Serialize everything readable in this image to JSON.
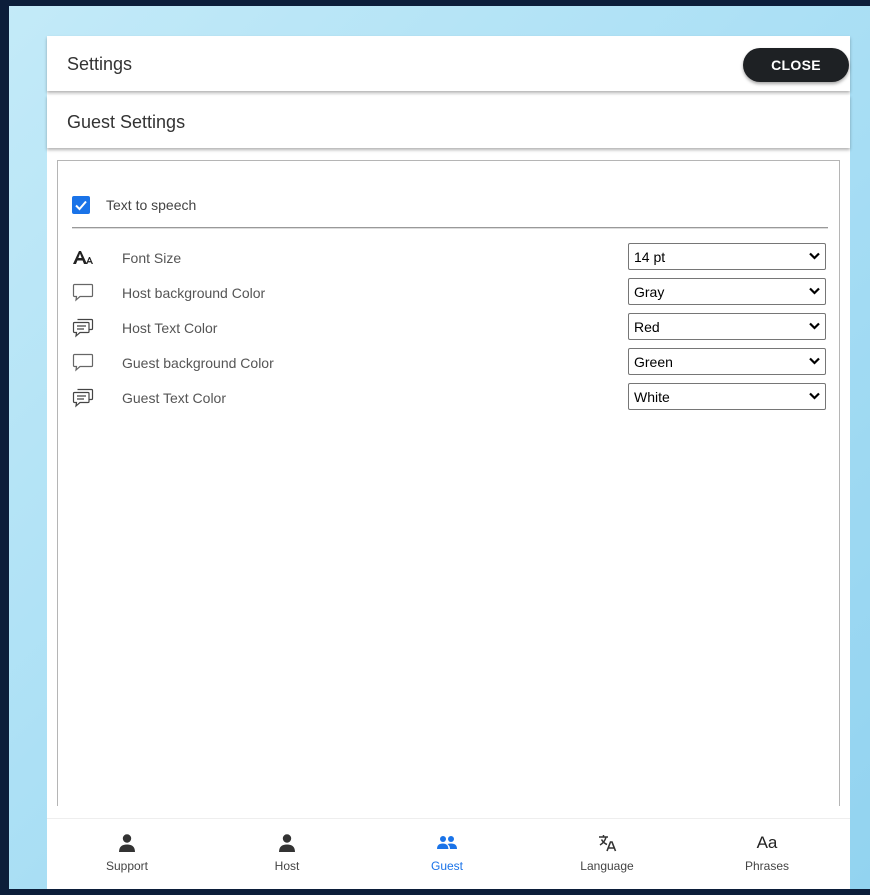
{
  "header": {
    "title": "Settings",
    "close_label": "CLOSE"
  },
  "subheader": {
    "title": "Guest Settings"
  },
  "text_to_speech": {
    "label": "Text to speech",
    "checked": true
  },
  "settings": [
    {
      "label": "Font Size",
      "value": "14 pt",
      "icon": "font-size-icon"
    },
    {
      "label": "Host background Color",
      "value": "Gray",
      "icon": "speech-bubble-icon"
    },
    {
      "label": "Host Text Color",
      "value": "Red",
      "icon": "chat-text-icon"
    },
    {
      "label": "Guest background Color",
      "value": "Green",
      "icon": "speech-bubble-icon"
    },
    {
      "label": "Guest Text Color",
      "value": "White",
      "icon": "chat-text-icon"
    }
  ],
  "nav": {
    "items": [
      {
        "label": "Support",
        "icon": "person-icon",
        "active": false
      },
      {
        "label": "Host",
        "icon": "person-icon",
        "active": false
      },
      {
        "label": "Guest",
        "icon": "people-icon",
        "active": true
      },
      {
        "label": "Language",
        "icon": "translate-icon",
        "active": false
      },
      {
        "label": "Phrases",
        "icon": "text-aa-icon",
        "glyph": "Aa",
        "active": false
      }
    ]
  },
  "colors": {
    "accent": "#1a73e8",
    "close_button": "#1e2124",
    "frame": "#0c1e3a",
    "backdrop": "#ace0f5"
  }
}
